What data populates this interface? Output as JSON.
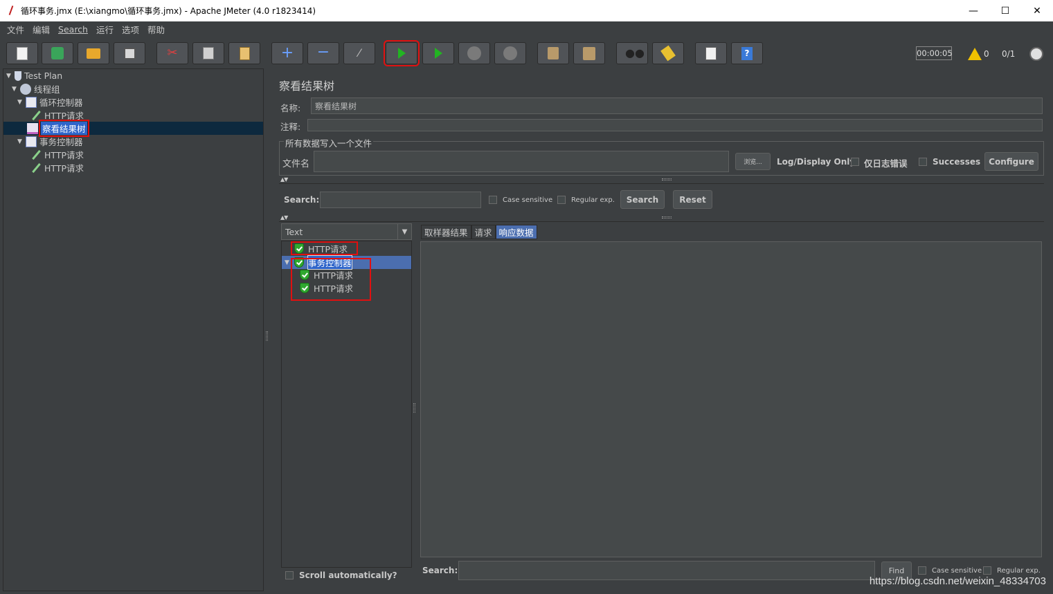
{
  "window": {
    "title": "循环事务.jmx (E:\\xiangmo\\循环事务.jmx) - Apache JMeter (4.0 r1823414)",
    "minimize": "—",
    "maximize": "☐",
    "close": "✕"
  },
  "menu": [
    "文件",
    "编辑",
    "Search",
    "运行",
    "选项",
    "帮助"
  ],
  "toolbar": {
    "buttons": [
      "new",
      "templates",
      "open",
      "save",
      "cut",
      "copy",
      "paste",
      "expand",
      "collapse",
      "toggle",
      "start",
      "start-no-pauses",
      "stop",
      "shutdown",
      "clear",
      "clear-all",
      "search",
      "reset-search",
      "function-helper",
      "help"
    ],
    "highlighted": "start",
    "timer": "00:00:05",
    "warnings": "0",
    "threads": "0/1"
  },
  "tree": {
    "test_plan": "Test Plan",
    "thread_group": "线程组",
    "loop_controller": "循环控制器",
    "http1": "HTTP请求",
    "view_results_tree": "察看结果树",
    "transaction_controller": "事务控制器",
    "http2": "HTTP请求",
    "http3": "HTTP请求"
  },
  "panel": {
    "title": "察看结果树",
    "name_label": "名称:",
    "name_value": "察看结果树",
    "comment_label": "注释:",
    "comment_value": "",
    "file_group_title": "所有数据写入一个文件",
    "filename_label": "文件名",
    "filename_value": "",
    "browse_label": "浏览...",
    "log_display_label": "Log/Display Only:",
    "errors_label": "仅日志错误",
    "successes_label": "Successes",
    "configure_label": "Configure",
    "search_label": "Search:",
    "search_value": "",
    "case_sensitive": "Case sensitive",
    "regex": "Regular exp.",
    "search_button": "Search",
    "reset_button": "Reset",
    "renderer": "Text",
    "results": {
      "http_top": "HTTP请求",
      "transaction": "事务控制器",
      "http_child1": "HTTP请求",
      "http_child2": "HTTP请求"
    },
    "tabs": [
      "取样器结果",
      "请求",
      "响应数据"
    ],
    "active_tab": "响应数据",
    "scroll_auto": "Scroll automatically?",
    "bottom_search_label": "Search:",
    "bottom_search_value": "",
    "find_button": "Find",
    "bottom_case": "Case sensitive",
    "bottom_regex": "Regular exp."
  },
  "watermark": "https://blog.csdn.net/weixin_48334703"
}
